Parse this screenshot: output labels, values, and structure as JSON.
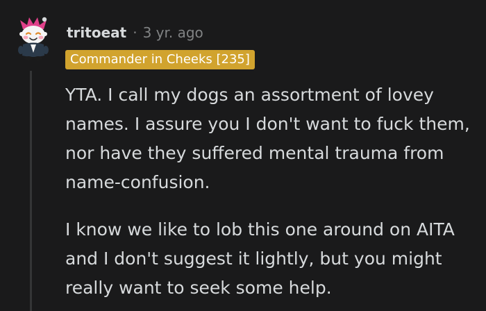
{
  "comment": {
    "author": "tritoeat",
    "separator": "·",
    "timestamp": "3 yr. ago",
    "flair": "Commander in Cheeks [235]",
    "paragraphs": [
      "YTA. I call my dogs an assortment of lovey names. I assure you I don't want to fuck them, nor have they suffered mental trauma from name-confusion.",
      "I know we like to lob this one around on AITA and I don't suggest it lightly, but you might really want to seek some help."
    ],
    "avatar_icon": "snoo-avatar-icon"
  },
  "colors": {
    "background": "#1a1a1b",
    "text": "#d7dadc",
    "meta": "#818384",
    "flair_bg": "#d1a32e",
    "thread_line": "#343536"
  }
}
